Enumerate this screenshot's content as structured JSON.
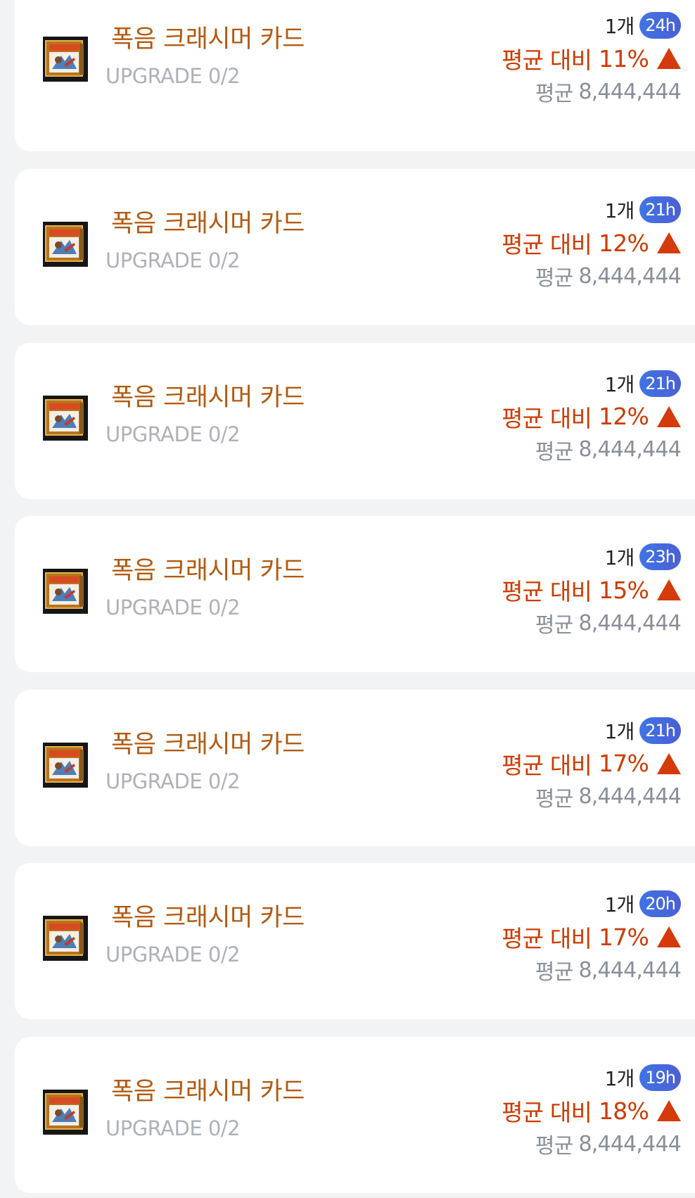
{
  "items": [
    {
      "name": "폭음 크래시머 카드",
      "upgrade": "UPGRADE 0/2",
      "quantity": "1개",
      "time_left": "24h",
      "compare_label": "평균 대비",
      "compare_pct": "11%",
      "avg_label": "평균",
      "avg_value": "8,444,444"
    },
    {
      "name": "폭음 크래시머 카드",
      "upgrade": "UPGRADE 0/2",
      "quantity": "1개",
      "time_left": "21h",
      "compare_label": "평균 대비",
      "compare_pct": "12%",
      "avg_label": "평균",
      "avg_value": "8,444,444"
    },
    {
      "name": "폭음 크래시머 카드",
      "upgrade": "UPGRADE 0/2",
      "quantity": "1개",
      "time_left": "21h",
      "compare_label": "평균 대비",
      "compare_pct": "12%",
      "avg_label": "평균",
      "avg_value": "8,444,444"
    },
    {
      "name": "폭음 크래시머 카드",
      "upgrade": "UPGRADE 0/2",
      "quantity": "1개",
      "time_left": "23h",
      "compare_label": "평균 대비",
      "compare_pct": "15%",
      "avg_label": "평균",
      "avg_value": "8,444,444"
    },
    {
      "name": "폭음 크래시머 카드",
      "upgrade": "UPGRADE 0/2",
      "quantity": "1개",
      "time_left": "21h",
      "compare_label": "평균 대비",
      "compare_pct": "17%",
      "avg_label": "평균",
      "avg_value": "8,444,444"
    },
    {
      "name": "폭음 크래시머 카드",
      "upgrade": "UPGRADE 0/2",
      "quantity": "1개",
      "time_left": "20h",
      "compare_label": "평균 대비",
      "compare_pct": "17%",
      "avg_label": "평균",
      "avg_value": "8,444,444"
    },
    {
      "name": "폭음 크래시머 카드",
      "upgrade": "UPGRADE 0/2",
      "quantity": "1개",
      "time_left": "19h",
      "compare_label": "평균 대비",
      "compare_pct": "18%",
      "avg_label": "평균",
      "avg_value": "8,444,444"
    }
  ],
  "colors": {
    "name": "#b25a10",
    "upgrade": "#aeb1b8",
    "compare": "#cc3b00",
    "arrow": "#d53a0a",
    "avg": "#898f9a",
    "badge": "#3f74e6",
    "background": "#f2f3f5"
  },
  "icons": {
    "item": "card-item-icon",
    "trend": "up-triangle-icon"
  }
}
